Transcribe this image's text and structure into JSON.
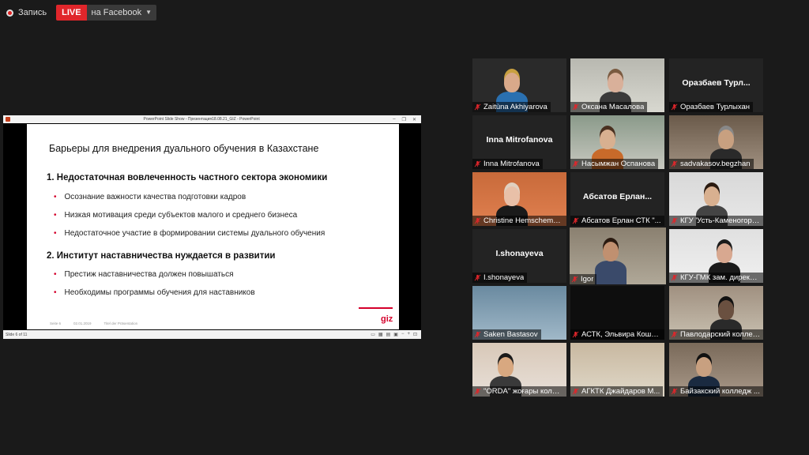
{
  "recording": {
    "label": "Запись",
    "live": "LIVE",
    "destination": "на Facebook"
  },
  "share": {
    "window_title": "PowerPoint Slide Show  -  Презентация18.08.21_GIZ - PowerPoint",
    "status": "Slide 6 of 11",
    "slide": {
      "title": "Барьеры для внедрения дуального обучения в Казахстане",
      "sections": [
        {
          "heading": "1.  Недостаточная вовлеченность частного сектора экономики",
          "bullets": [
            "Осознание важности качества подготовки кадров",
            "Низкая мотивация среди субъектов малого и среднего бизнеса",
            "Недостаточное участие в формировании системы дуального обучения"
          ]
        },
        {
          "heading": "2.  Институт наставничества нуждается в развитии",
          "bullets": [
            "Престиж наставничества должен повышаться",
            "Необходимы программы обучения для наставников"
          ]
        }
      ],
      "logo": "giz",
      "footer": [
        "Seite 6",
        "02.01.2019",
        "Titel der Präsentation"
      ]
    }
  },
  "participants": [
    {
      "name": "Zaitùna Akhiyarova",
      "center": ""
    },
    {
      "name": "Оксана Масалова",
      "center": ""
    },
    {
      "name": "Оразбаев Турлыхан",
      "center": "Оразбаев  Турл..."
    },
    {
      "name": "Inna Mitrofanova",
      "center": "Inna Mitrofanova"
    },
    {
      "name": "Насымжан Оспанова",
      "center": ""
    },
    {
      "name": "sadvakasov.begzhan",
      "center": ""
    },
    {
      "name": "Christine Hemschemeier",
      "center": ""
    },
    {
      "name": "Абсатов Ерлан СТК \"...",
      "center": "Абсатов  Ерлан..."
    },
    {
      "name": "КГУ 'Усть-Каменогорск...",
      "center": ""
    },
    {
      "name": "I.shonayeva",
      "center": "I.shonayeva"
    },
    {
      "name": "Igor",
      "center": ""
    },
    {
      "name": "КГУ-ГМК зам. директора...",
      "center": ""
    },
    {
      "name": "Saken Bastasov",
      "center": ""
    },
    {
      "name": "АСТК, Эльвира Кошкен...",
      "center": ""
    },
    {
      "name": "Павлодарский колледж...",
      "center": ""
    },
    {
      "name": "\"ORDA\" жоғары колледжі",
      "center": ""
    },
    {
      "name": "АГКТК Джайдаров М...",
      "center": ""
    },
    {
      "name": "Байзакский колледж ...",
      "center": ""
    }
  ],
  "colors": {
    "live_red": "#e0262b",
    "active_border": "#c8e62a",
    "bullet_red": "#d4002b",
    "muted_mic": "#e0262b"
  }
}
